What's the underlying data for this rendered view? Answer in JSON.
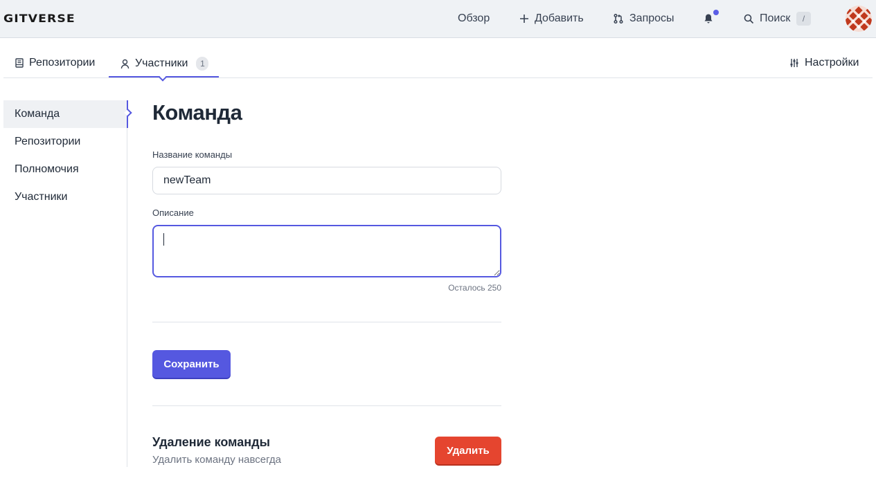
{
  "header": {
    "logo": "GITVERSE",
    "nav": {
      "overview": "Обзор",
      "add": "Добавить",
      "requests": "Запросы",
      "search": "Поиск",
      "search_shortcut": "/"
    }
  },
  "tabs": {
    "repositories": "Репозитории",
    "members": "Участники",
    "members_count": "1",
    "settings": "Настройки"
  },
  "sidebar": {
    "items": [
      {
        "label": "Команда"
      },
      {
        "label": "Репозитории"
      },
      {
        "label": "Полномочия"
      },
      {
        "label": "Участники"
      }
    ]
  },
  "main": {
    "title": "Команда",
    "name_label": "Название команды",
    "name_value": "newTeam",
    "description_label": "Описание",
    "description_value": "",
    "chars_left": "Осталось 250",
    "save_button": "Сохранить",
    "delete_title": "Удаление команды",
    "delete_subtitle": "Удалить команду навсегда",
    "delete_button": "Удалить"
  },
  "colors": {
    "accent": "#5558e0",
    "danger": "#e5452f",
    "topbar_bg": "#eff2f5"
  }
}
